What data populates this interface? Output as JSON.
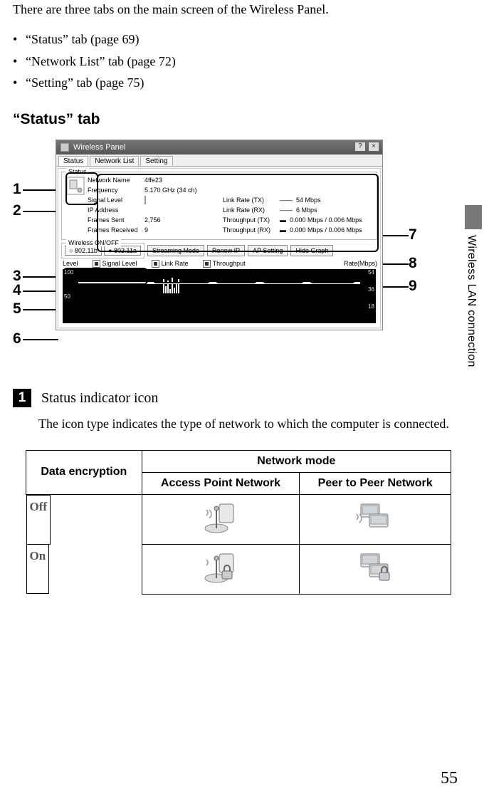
{
  "intro": "There are three tabs on the main screen of the Wireless Panel.",
  "bullets": [
    "“Status” tab (page 69)",
    "“Network List” tab (page 72)",
    "“Setting” tab (page 75)"
  ],
  "section_heading": "“Status” tab",
  "callouts": {
    "1": "1",
    "2": "2",
    "3": "3",
    "4": "4",
    "5": "5",
    "6": "6",
    "7": "7",
    "8": "8",
    "9": "9"
  },
  "panel": {
    "title": "Wireless Panel",
    "help": "?",
    "close": "×",
    "tabs": {
      "status": "Status",
      "netlist": "Network List",
      "setting": "Setting"
    },
    "group_caption": "Status",
    "rows": {
      "network_name_label": "Network Name",
      "network_name_value": "4ffe23",
      "frequency_label": "Frequency",
      "frequency_value": "5.170 GHz (34 ch)",
      "signal_label": "Signal Level",
      "ip_label": "IP Address",
      "frames_sent_label": "Frames Sent",
      "frames_sent_value": "2,756",
      "frames_recv_label": "Frames Received",
      "frames_recv_value": "9",
      "linkrate_tx_label": "Link Rate (TX)",
      "linkrate_tx_value": "54 Mbps",
      "linkrate_rx_label": "Link Rate (RX)",
      "linkrate_rx_value": "6 Mbps",
      "throughput_tx_label": "Throughput (TX)",
      "throughput_tx_value": "0.000 Mbps / 0.006 Mbps",
      "throughput_rx_label": "Throughput (RX)",
      "throughput_rx_value": "0.000 Mbps / 0.006 Mbps"
    },
    "onoff_caption": "Wireless ON/OFF",
    "radio_b": "○ 802.11b",
    "radio_a": "● 802.11a",
    "btn_streaming": "Streaming Mode",
    "btn_renew": "Renew IP",
    "btn_apsetting": "AP Setting",
    "btn_hidegraph": "Hide Graph",
    "chk_level": "Level",
    "chk_signal": "Signal Level",
    "chk_linkrate": "Link Rate",
    "chk_throughput": "Throughput",
    "rate_label": "Rate(Mbps)",
    "yleft": {
      "100": "100",
      "50": "50"
    },
    "yright": {
      "54": "54",
      "36": "36",
      "18": "18"
    }
  },
  "side_tab": "Wireless LAN connection",
  "step": {
    "num": "1",
    "title": "Status indicator icon",
    "text": "The icon type indicates the type of network to which the computer is connected."
  },
  "table": {
    "col1": "Data encryption",
    "col2_top": "Network mode",
    "col2a": "Access Point Network",
    "col2b": "Peer to Peer Network",
    "row1": "Off",
    "row2": "On"
  },
  "pagenum": "55",
  "chart_data": {
    "type": "line",
    "left_axis": {
      "label": "Level",
      "range": [
        0,
        100
      ],
      "ticks": [
        50,
        100
      ]
    },
    "right_axis": {
      "label": "Rate(Mbps)",
      "range": [
        0,
        54
      ],
      "ticks": [
        18,
        36,
        54
      ]
    },
    "series": [
      {
        "name": "Signal Level",
        "approx_values": [
          80,
          80,
          80,
          80,
          80,
          80,
          80,
          80,
          80,
          80
        ]
      },
      {
        "name": "Link Rate",
        "approx_values": [
          54,
          54,
          48,
          54,
          36,
          54,
          54,
          54,
          54,
          54
        ]
      },
      {
        "name": "Throughput",
        "approx_values": [
          0,
          0,
          0,
          0,
          0,
          0,
          0,
          0,
          0,
          0
        ]
      }
    ],
    "note": "Values estimated from miniature graph inside screenshot; precise readings not legible."
  }
}
